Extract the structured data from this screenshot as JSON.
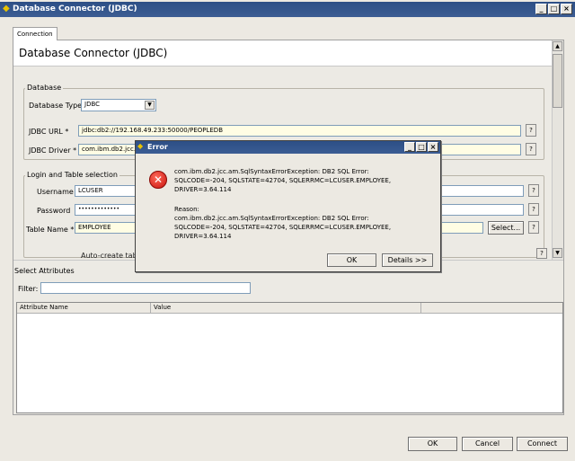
{
  "window": {
    "title": "Database Connector (JDBC)",
    "controls": [
      "_",
      "□",
      "×"
    ]
  },
  "tab": {
    "label": "Connection"
  },
  "page_title": "Database Connector (JDBC)",
  "database_group": {
    "legend": "Database",
    "db_type_label": "Database Type",
    "db_type_value": "JDBC",
    "jdbc_url_label": "JDBC URL *",
    "jdbc_url_value": "jdbc:db2://192.168.49.233:50000/PEOPLEDB",
    "jdbc_driver_label": "JDBC Driver *",
    "jdbc_driver_value": "com.ibm.db2.jcc.",
    "help": "?"
  },
  "login_group": {
    "legend": "Login and Table selection",
    "username_label": "Username",
    "username_value": "LCUSER",
    "password_label": "Password",
    "password_value": "•••••••••••••",
    "table_label": "Table Name *",
    "table_value": "EMPLOYEE",
    "select_button": "Select...",
    "autocreate_label": "Auto-create tab",
    "help": "?"
  },
  "attributes": {
    "section_label": "Select Attributes",
    "filter_label": "Filter:",
    "filter_value": "",
    "columns": [
      "Attribute Name",
      "Value"
    ]
  },
  "footer": {
    "ok": "OK",
    "cancel": "Cancel",
    "connect": "Connect"
  },
  "error_dialog": {
    "title": "Error",
    "controls": [
      "_",
      "□",
      "×"
    ],
    "message_lines": [
      "com.ibm.db2.jcc.am.SqlSyntaxErrorException: DB2 SQL Error:",
      "SQLCODE=-204, SQLSTATE=42704, SQLERRMC=LCUSER.EMPLOYEE,",
      "DRIVER=3.64.114"
    ],
    "reason_label": "Reason:",
    "reason_lines": [
      "com.ibm.db2.jcc.am.SqlSyntaxErrorException: DB2 SQL Error:",
      "SQLCODE=-204, SQLSTATE=42704, SQLERRMC=LCUSER.EMPLOYEE,",
      "DRIVER=3.64.114"
    ],
    "ok": "OK",
    "details": "Details >>",
    "icon": "error-icon"
  },
  "colors": {
    "titlebar": "#2d4f86",
    "required_field": "#fffde4",
    "error_icon": "#c8140e"
  }
}
